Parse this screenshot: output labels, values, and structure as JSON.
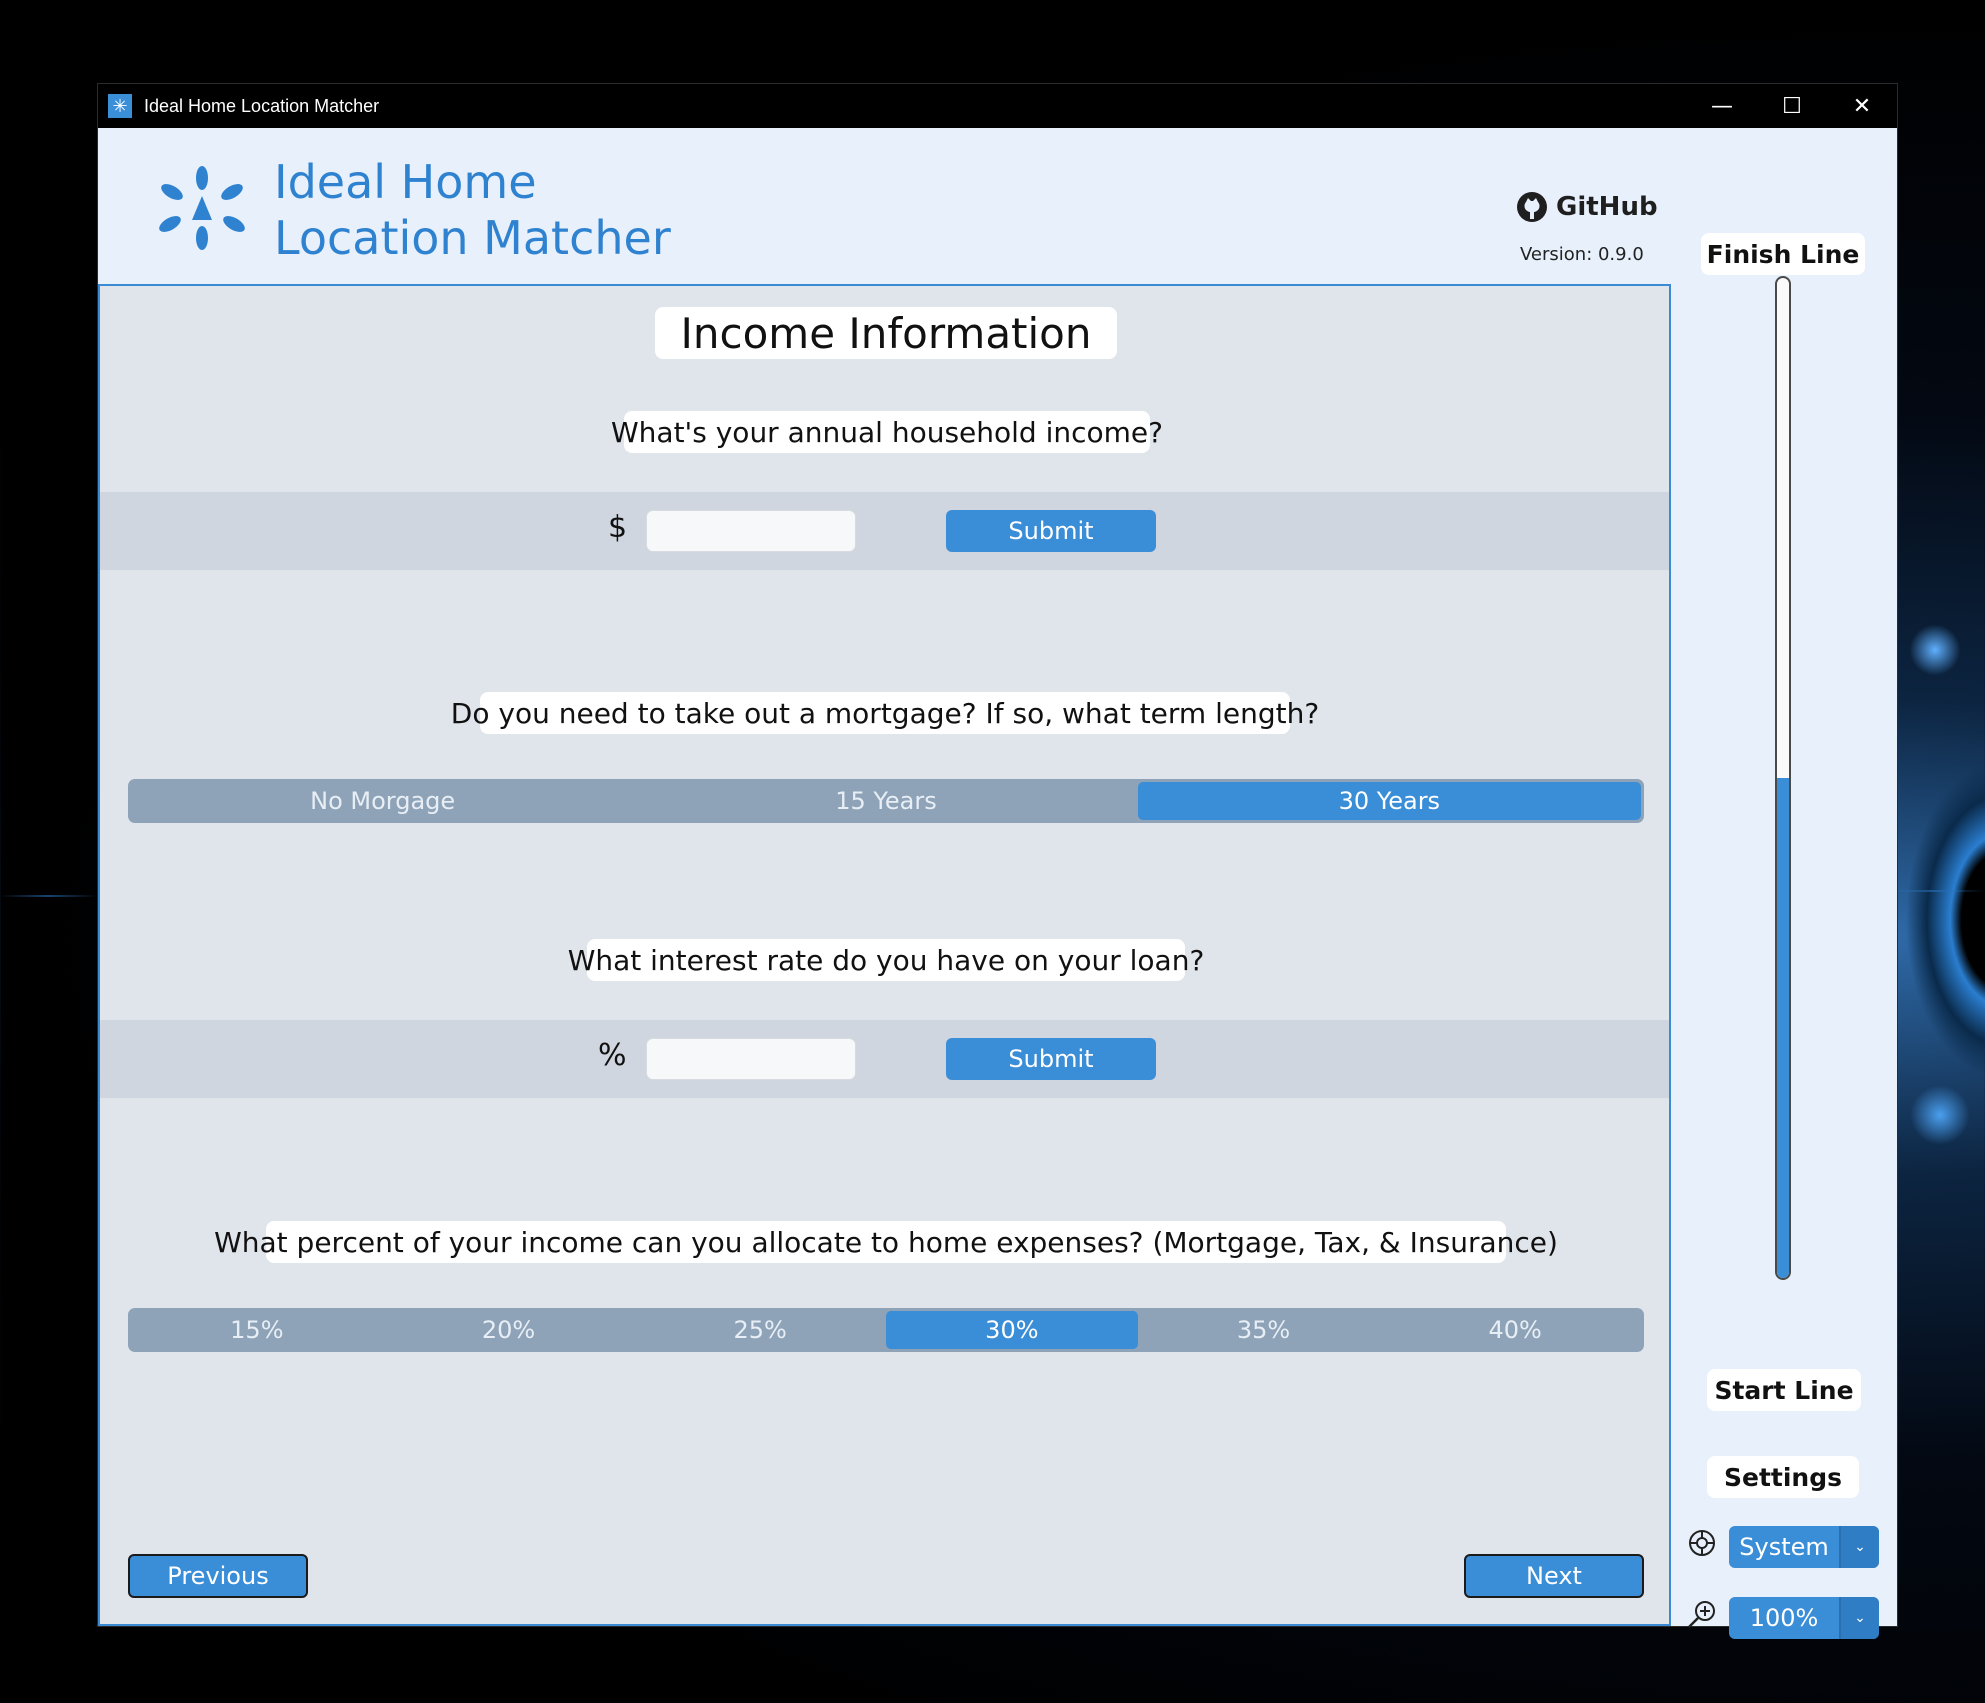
{
  "window": {
    "title": "Ideal Home Location Matcher",
    "controls": {
      "minimize": "—",
      "maximize": "☐",
      "close": "✕"
    }
  },
  "header": {
    "brand_line1": "Ideal Home",
    "brand_line2": "Location Matcher",
    "github_label": "GitHub",
    "version": "Version: 0.9.0"
  },
  "main": {
    "title": "Income Information",
    "income": {
      "question": "What's your annual household income?",
      "prefix": "$",
      "value": "",
      "submit_label": "Submit"
    },
    "mortgage": {
      "question": "Do you need to take out a mortgage? If so, what term length?",
      "options": [
        "No Morgage",
        "15 Years",
        "30 Years"
      ],
      "selected": "30 Years"
    },
    "interest": {
      "question": "What interest rate do you have on your loan?",
      "prefix": "%",
      "value": "",
      "submit_label": "Submit"
    },
    "allocation": {
      "question": "What percent of your income can you allocate to home expenses? (Mortgage, Tax, & Insurance)",
      "options": [
        "15%",
        "20%",
        "25%",
        "30%",
        "35%",
        "40%"
      ],
      "selected": "30%"
    },
    "nav": {
      "previous_label": "Previous",
      "next_label": "Next"
    }
  },
  "sidebar": {
    "finish_label": "Finish Line",
    "start_label": "Start Line",
    "progress_fraction": 0.5,
    "settings_label": "Settings",
    "theme_value": "System",
    "zoom_value": "100%"
  },
  "colors": {
    "accent": "#3a8dd7",
    "header_bg": "#e8f1fb",
    "main_bg": "#e0e4eb",
    "segment_bg": "#8ea3b8"
  }
}
